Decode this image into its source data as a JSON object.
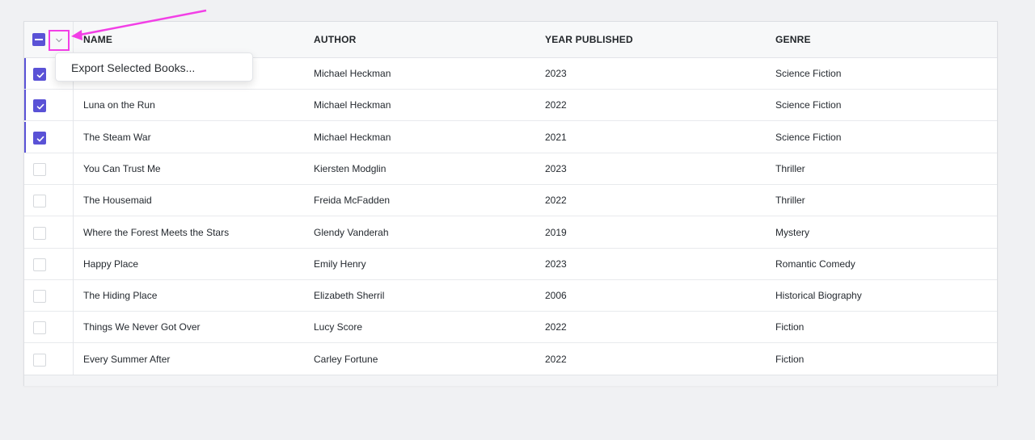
{
  "columns": {
    "name": "NAME",
    "author": "AUTHOR",
    "year": "YEAR PUBLISHED",
    "genre": "GENRE"
  },
  "dropdown": {
    "export_label": "Export Selected Books..."
  },
  "rows": [
    {
      "name": "",
      "author": "Michael Heckman",
      "year": "2023",
      "genre": "Science Fiction",
      "selected": true
    },
    {
      "name": "Luna on the Run",
      "author": "Michael Heckman",
      "year": "2022",
      "genre": "Science Fiction",
      "selected": true
    },
    {
      "name": "The Steam War",
      "author": "Michael Heckman",
      "year": "2021",
      "genre": "Science Fiction",
      "selected": true
    },
    {
      "name": "You Can Trust Me",
      "author": "Kiersten Modglin",
      "year": "2023",
      "genre": "Thriller",
      "selected": false
    },
    {
      "name": "The Housemaid",
      "author": "Freida McFadden",
      "year": "2022",
      "genre": "Thriller",
      "selected": false
    },
    {
      "name": "Where the Forest Meets the Stars",
      "author": "Glendy Vanderah",
      "year": "2019",
      "genre": "Mystery",
      "selected": false
    },
    {
      "name": "Happy Place",
      "author": "Emily Henry",
      "year": "2023",
      "genre": "Romantic Comedy",
      "selected": false
    },
    {
      "name": "The Hiding Place",
      "author": "Elizabeth Sherril",
      "year": "2006",
      "genre": "Historical Biography",
      "selected": false
    },
    {
      "name": "Things We Never Got Over",
      "author": "Lucy Score",
      "year": "2022",
      "genre": "Fiction",
      "selected": false
    },
    {
      "name": "Every Summer After",
      "author": "Carley Fortune",
      "year": "2022",
      "genre": "Fiction",
      "selected": false
    }
  ],
  "colors": {
    "accent": "#5a52d6",
    "annotation": "#f23fe6"
  },
  "icons": {
    "select_all": "indeterminate-checkbox-icon",
    "menu_trigger": "chevron-down-icon",
    "row_checked": "checkmark-icon"
  }
}
